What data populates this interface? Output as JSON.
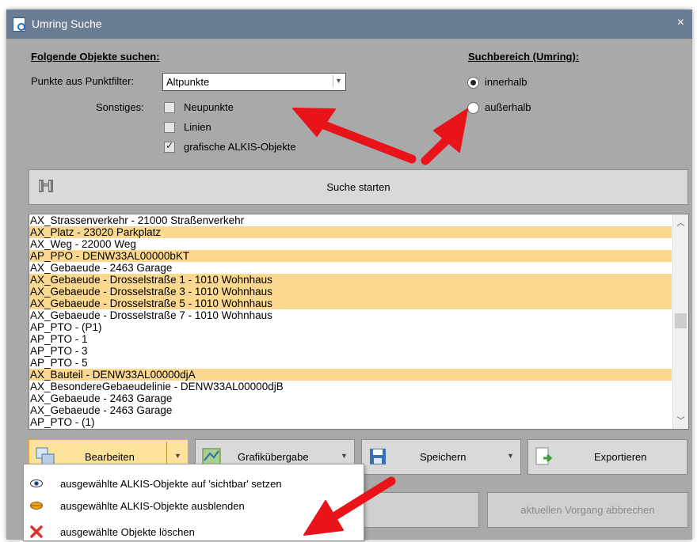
{
  "window": {
    "title": "Umring Suche",
    "close_label": "×"
  },
  "search_objects": {
    "heading": "Folgende Objekte suchen:",
    "filter_label": "Punkte aus Punktfilter:",
    "filter_value": "Altpunkte",
    "misc_label": "Sonstiges:",
    "options": [
      {
        "label": "Neupunkte",
        "checked": false
      },
      {
        "label": "Linien",
        "checked": false
      },
      {
        "label": "grafische ALKIS-Objekte",
        "checked": true
      }
    ]
  },
  "search_area": {
    "heading": "Suchbereich (Umring):",
    "options": [
      {
        "label": "innerhalb",
        "selected": true
      },
      {
        "label": "außerhalb",
        "selected": false
      }
    ]
  },
  "start_button": {
    "label": "Suche starten"
  },
  "results": [
    {
      "text": "AX_Strassenverkehr - 21000 Straßenverkehr",
      "selected": false
    },
    {
      "text": "AX_Platz - 23020 Parkplatz",
      "selected": true
    },
    {
      "text": "AX_Weg - 22000 Weg",
      "selected": false
    },
    {
      "text": "AP_PPO - DENW33AL00000bKT",
      "selected": true
    },
    {
      "text": "AX_Gebaeude - 2463 Garage",
      "selected": false
    },
    {
      "text": "AX_Gebaeude - Drosselstraße 1 - 1010 Wohnhaus",
      "selected": true
    },
    {
      "text": "AX_Gebaeude - Drosselstraße 3 - 1010 Wohnhaus",
      "selected": true
    },
    {
      "text": "AX_Gebaeude - Drosselstraße 5 - 1010 Wohnhaus",
      "selected": true
    },
    {
      "text": "AX_Gebaeude - Drosselstraße 7 - 1010 Wohnhaus",
      "selected": false
    },
    {
      "text": "AP_PTO - (P1)",
      "selected": false
    },
    {
      "text": "AP_PTO - 1",
      "selected": false
    },
    {
      "text": "AP_PTO - 3",
      "selected": false
    },
    {
      "text": "AP_PTO - 5",
      "selected": false
    },
    {
      "text": "AX_Bauteil - DENW33AL00000djA",
      "selected": true
    },
    {
      "text": "AX_BesondereGebaeudelinie - DENW33AL00000djB",
      "selected": false
    },
    {
      "text": "AX_Gebaeude - 2463 Garage",
      "selected": false
    },
    {
      "text": "AX_Gebaeude - 2463 Garage",
      "selected": false
    },
    {
      "text": "AP_PTO - (1)",
      "selected": false
    }
  ],
  "toolbar": {
    "edit_label": "Bearbeiten",
    "graphics_label": "Grafikübergabe",
    "save_label": "Speichern",
    "export_label": "Exportieren"
  },
  "cancel_label": "aktuellen Vorgang abbrechen",
  "menu": [
    {
      "label": "ausgewählte ALKIS-Objekte auf 'sichtbar' setzen",
      "icon": "eye-icon"
    },
    {
      "label": "ausgewählte ALKIS-Objekte ausblenden",
      "icon": "hide-icon"
    },
    {
      "label": "ausgewählte Objekte löschen",
      "icon": "delete-icon"
    }
  ],
  "colors": {
    "selection": "#fbd88f",
    "titlebar": "#6a7d93",
    "annotation_arrow": "#e8141a"
  }
}
